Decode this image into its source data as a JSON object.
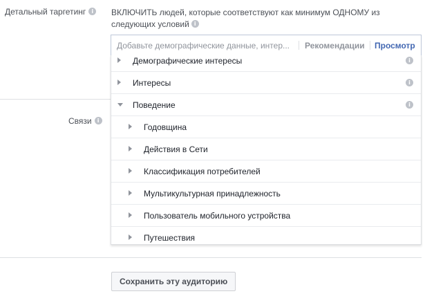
{
  "detailed_targeting": {
    "label": "Детальный таргетинг",
    "include_text": "ВКЛЮЧИТЬ людей, которые соответствуют как минимум ОДНОМУ из следующих условий"
  },
  "search": {
    "placeholder": "Добавьте демографические данные, интер...",
    "value": "",
    "recommendations_label": "Рекомендации",
    "browse_label": "Просмотр"
  },
  "dropdown": {
    "items": [
      {
        "label": "Демографические интересы",
        "expanded": false,
        "level": 0,
        "has_info": true
      },
      {
        "label": "Интересы",
        "expanded": false,
        "level": 0,
        "has_info": true
      },
      {
        "label": "Поведение",
        "expanded": true,
        "level": 0,
        "has_info": true
      },
      {
        "label": "Годовщина",
        "expanded": false,
        "level": 1,
        "has_info": false
      },
      {
        "label": "Действия в Сети",
        "expanded": false,
        "level": 1,
        "has_info": false
      },
      {
        "label": "Классификация потребителей",
        "expanded": false,
        "level": 1,
        "has_info": false
      },
      {
        "label": "Мультикультурная принадлежность",
        "expanded": false,
        "level": 1,
        "has_info": false
      },
      {
        "label": "Пользователь мобильного устройства",
        "expanded": false,
        "level": 1,
        "has_info": false
      },
      {
        "label": "Путешествия",
        "expanded": false,
        "level": 1,
        "has_info": false
      }
    ]
  },
  "connections": {
    "label": "Связи"
  },
  "save_button_label": "Сохранить эту аудиторию",
  "colors": {
    "accent": "#4267b2",
    "text": "#4b4f56",
    "muted": "#90949c",
    "border": "#dddfe2"
  },
  "icons": {
    "info": "info-icon",
    "collapsed": "triangle-right-icon",
    "expanded": "triangle-down-icon"
  }
}
